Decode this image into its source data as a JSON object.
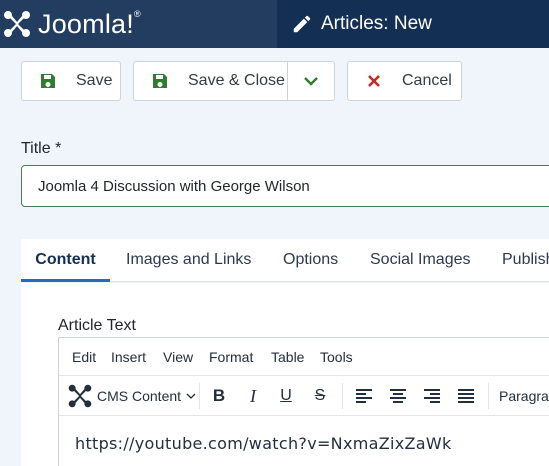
{
  "header": {
    "logo_text": "Joomla!",
    "logo_mark": "®",
    "page_title": "Articles: New",
    "page_icon": "pencil-icon"
  },
  "toolbar": {
    "save_label": "Save",
    "save_close_label": "Save & Close",
    "cancel_label": "Cancel",
    "save_icon_color": "#2f7d32",
    "cancel_icon_color": "#c52827"
  },
  "form": {
    "title_label": "Title *",
    "title_value": "Joomla 4 Discussion with George Wilson"
  },
  "tabs": [
    {
      "label": "Content",
      "active": true
    },
    {
      "label": "Images and Links"
    },
    {
      "label": "Options"
    },
    {
      "label": "Social Images"
    },
    {
      "label": "Publishing"
    }
  ],
  "editor": {
    "label": "Article Text",
    "menu": [
      "Edit",
      "Insert",
      "View",
      "Format",
      "Table",
      "Tools"
    ],
    "cms_content_label": "CMS Content",
    "bold": "B",
    "italic": "I",
    "underline": "U",
    "strike": "S",
    "paragraph_label": "Paragraph",
    "body_text": "https://youtube.com/watch?v=NxmaZixZaWk"
  },
  "colors": {
    "header_bg": "#132f53",
    "brand_bg": "#233d60",
    "accent": "#2a69b8",
    "input_border": "#457d54"
  }
}
